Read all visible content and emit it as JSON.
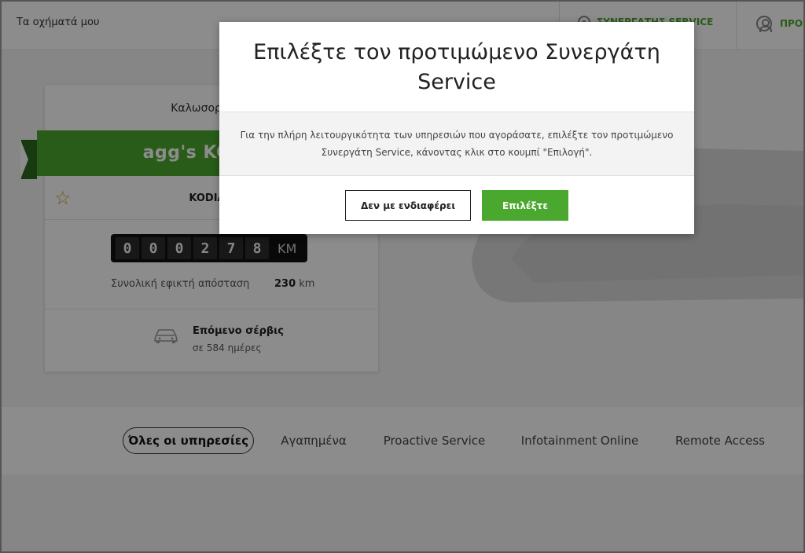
{
  "header": {
    "title": "Τα οχήματά μου",
    "partner_label": "ΣΥΝΕΡΓΑΤΗΣ SERVICE",
    "profile_label": "ΠΡΟ"
  },
  "card": {
    "welcome": "Καλωσορίσατε",
    "vehicle_name": "agg's KODIAQ",
    "model": "KODIAQ",
    "odometer_digits": [
      "0",
      "0",
      "0",
      "2",
      "7",
      "8"
    ],
    "odometer_unit": "KM",
    "distance_label": "Συνολική εφικτή απόσταση",
    "distance_value": "230",
    "distance_unit": "km",
    "next_service_label": "Επόμενο σέρβις",
    "next_service_value": "σε 584 ημέρες"
  },
  "tabs": [
    {
      "label": "Όλες οι υπηρεσίες",
      "active": true
    },
    {
      "label": "Αγαπημένα"
    },
    {
      "label": "Proactive Service"
    },
    {
      "label": "Infotainment Online"
    },
    {
      "label": "Remote Access"
    }
  ],
  "modal": {
    "title": "Επιλέξτε τον προτιμώμενο Συνεργάτη Service",
    "body": "Για την πλήρη λειτουργικότητα των υπηρεσιών που αγοράσατε, επιλέξτε τον προτιμώμενο Συνεργάτη Service, κάνοντας κλικ στο κουμπί \"Επιλογή\".",
    "decline_label": "Δεν με ενδιαφέρει",
    "select_label": "Επιλέξτε"
  },
  "colors": {
    "brand_green": "#4ba82e",
    "dark_green": "#2c6b1e"
  }
}
